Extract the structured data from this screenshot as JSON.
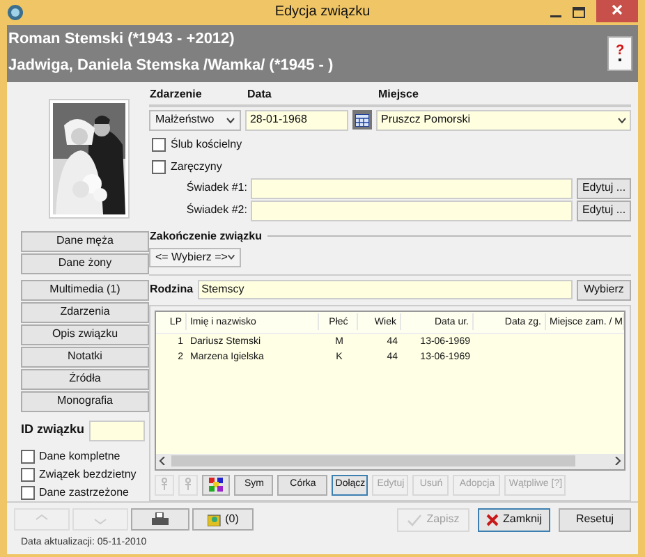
{
  "window": {
    "title": "Edycja związku"
  },
  "header": {
    "husband": "Roman Stemski (*1943 - +2012)",
    "wife": "Jadwiga, Daniela Stemska /Wamka/ (*1945 - )",
    "help_button": "?"
  },
  "side_buttons": [
    {
      "label": "Dane męża"
    },
    {
      "label": "Dane żony"
    },
    {
      "label": "Multimedia (1)"
    },
    {
      "label": "Zdarzenia"
    },
    {
      "label": "Opis związku"
    },
    {
      "label": "Notatki"
    },
    {
      "label": "Źródła"
    },
    {
      "label": "Monografia"
    }
  ],
  "id_field": {
    "label": "ID związku"
  },
  "flags": [
    {
      "label": "Dane kompletne",
      "checked": false
    },
    {
      "label": "Związek bezdzietny",
      "checked": false
    },
    {
      "label": "Dane zastrzeżone",
      "checked": false
    }
  ],
  "event": {
    "headings": [
      "Zdarzenie",
      "Data",
      "Miejsce"
    ],
    "type": "Małżeństwo",
    "date": "28-01-1968",
    "place": "Pruszcz Pomorski"
  },
  "options": [
    {
      "label": "Ślub kościelny",
      "checked": false
    },
    {
      "label": "Zaręczyny",
      "checked": false
    }
  ],
  "witnesses": [
    {
      "label": "Świadek #1:",
      "button": "Edytuj ..."
    },
    {
      "label": "Świadek #2:",
      "button": "Edytuj ..."
    }
  ],
  "ending": {
    "heading": "Zakończenie związku",
    "value": "<= Wybierz =>"
  },
  "family": {
    "label": "Rodzina",
    "value": "Stemscy",
    "button": "Wybierz"
  },
  "table": {
    "columns": [
      "LP",
      "Imię i nazwisko",
      "Płeć",
      "Wiek",
      "Data ur.",
      "Data zg.",
      "Miejsce zam. / M"
    ],
    "rows": [
      [
        "1",
        "Dariusz Stemski",
        "M",
        "44",
        "13-06-1969"
      ],
      [
        "2",
        "Marzena Igielska",
        "K",
        "44",
        "13-06-1969"
      ]
    ]
  },
  "table_buttons": [
    {
      "label": "Sym",
      "disabled": false,
      "focused": false
    },
    {
      "label": "Córka",
      "disabled": false,
      "focused": false
    },
    {
      "label": "Dołącz",
      "disabled": false,
      "focused": true
    },
    {
      "label": "Edytuj",
      "disabled": true,
      "focused": false
    },
    {
      "label": "Usuń",
      "disabled": true,
      "focused": false
    },
    {
      "label": "Adopcja",
      "disabled": true,
      "focused": false
    },
    {
      "label": "Wątpliwe [?]",
      "disabled": true,
      "focused": false
    }
  ],
  "images_button": "(0)",
  "footer": {
    "updated": "Data aktualizacji: 05-11-2010"
  },
  "buttons": [
    {
      "label": "Zapisz",
      "disabled": true,
      "focused": false
    },
    {
      "label": "Zamknij",
      "disabled": false,
      "focused": true
    },
    {
      "label": "Resetuj",
      "disabled": false,
      "focused": false
    }
  ]
}
